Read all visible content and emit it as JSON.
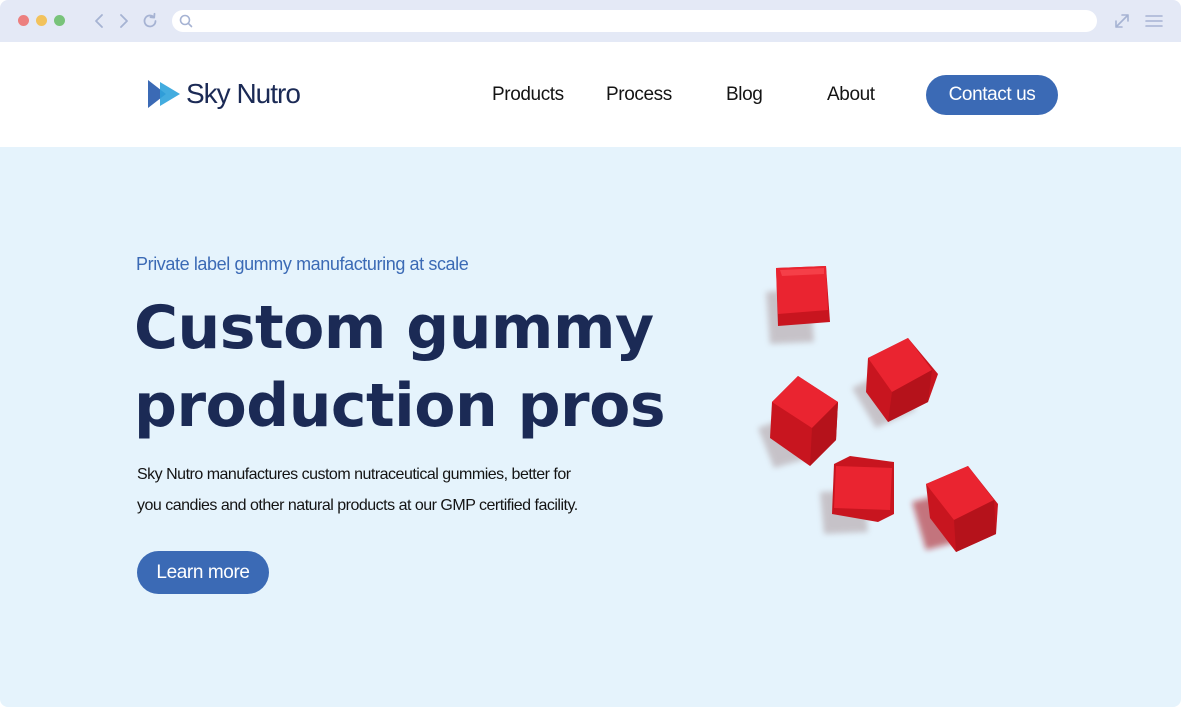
{
  "browser": {
    "url": "",
    "icons": {
      "back": "chevron-left-icon",
      "forward": "chevron-right-icon",
      "reload": "reload-icon",
      "search": "search-icon",
      "expand": "expand-icon",
      "menu": "hamburger-menu-icon"
    }
  },
  "header": {
    "logo_text": "Sky Nutro",
    "nav": {
      "products": "Products",
      "process": "Process",
      "blog": "Blog",
      "about": "About"
    },
    "contact_label": "Contact us"
  },
  "hero": {
    "eyebrow": "Private label gummy manufacturing at scale",
    "headline_line1": "Custom gummy",
    "headline_line2": "production pros",
    "description_line1": "Sky Nutro manufactures custom nutraceutical gummies, better for",
    "description_line2": "you candies and other natural products at our GMP certified facility.",
    "cta_label": "Learn more"
  },
  "colors": {
    "brand_blue": "#3b6ab5",
    "navy": "#1b2a55",
    "hero_bg": "#e5f3fc",
    "chrome_bg": "#e4e9f6",
    "gummy_red": "#e8222e"
  }
}
